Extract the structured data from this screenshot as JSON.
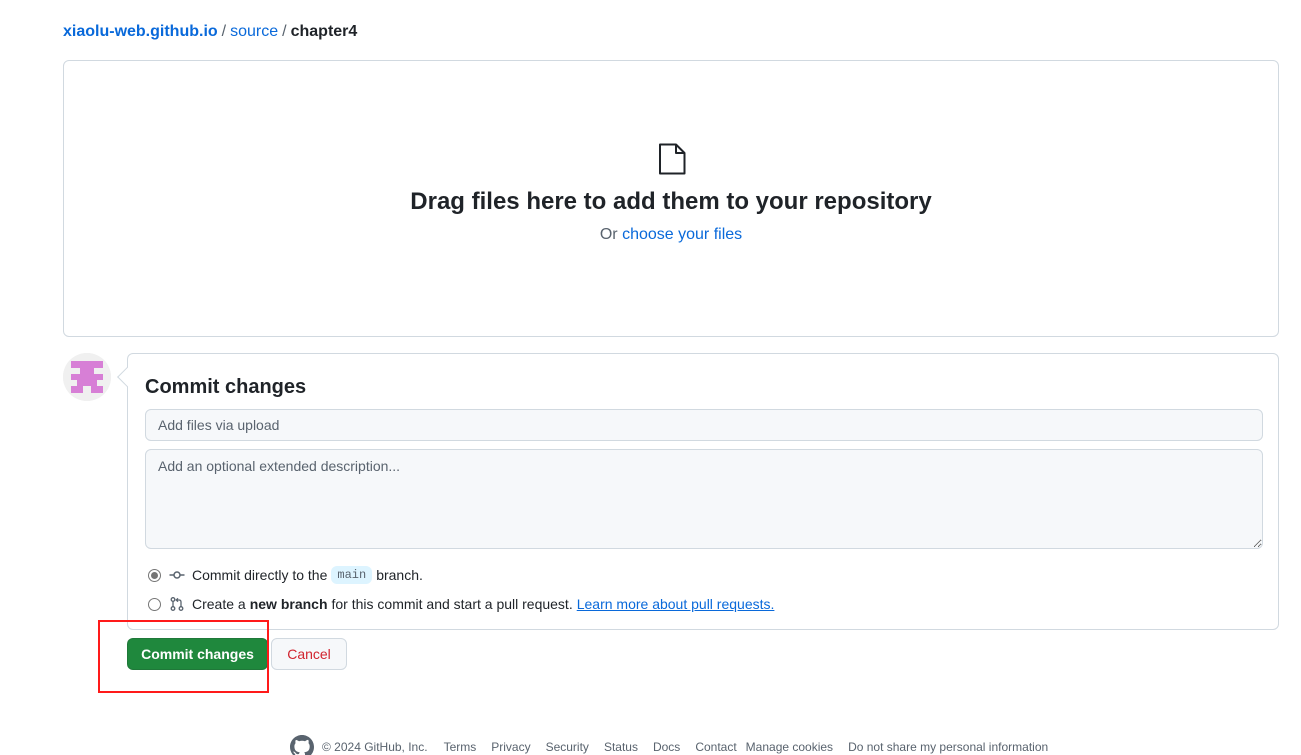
{
  "breadcrumb": {
    "repo": "xiaolu-web.github.io",
    "folder": "source",
    "current": "chapter4",
    "separator": "/"
  },
  "dropzone": {
    "title": "Drag files here to add them to your repository",
    "or_text": "Or",
    "choose_link": "choose your files",
    "icon": "file-icon"
  },
  "commit": {
    "heading": "Commit changes",
    "summary_placeholder": "Add files via upload",
    "summary_value": "",
    "description_placeholder": "Add an optional extended description...",
    "description_value": "",
    "options": {
      "direct": {
        "prefix": "Commit directly to the",
        "branch": "main",
        "suffix": "branch.",
        "selected": true,
        "icon": "git-commit-icon"
      },
      "new_branch": {
        "prefix": "Create a",
        "bold": "new branch",
        "suffix": "for this commit and start a pull request.",
        "link": "Learn more about pull requests.",
        "selected": false,
        "icon": "git-pull-request-icon"
      }
    }
  },
  "buttons": {
    "commit": "Commit changes",
    "cancel": "Cancel"
  },
  "footer": {
    "copyright": "© 2024 GitHub, Inc.",
    "links": [
      "Terms",
      "Privacy",
      "Security",
      "Status",
      "Docs",
      "Contact",
      "Manage cookies",
      "Do not share my personal information"
    ]
  },
  "colors": {
    "link": "#0969da",
    "primary_button": "#1f883d",
    "cancel_text": "#d1242f",
    "highlight": "#ff1a1a",
    "border": "#d1d9e0"
  }
}
